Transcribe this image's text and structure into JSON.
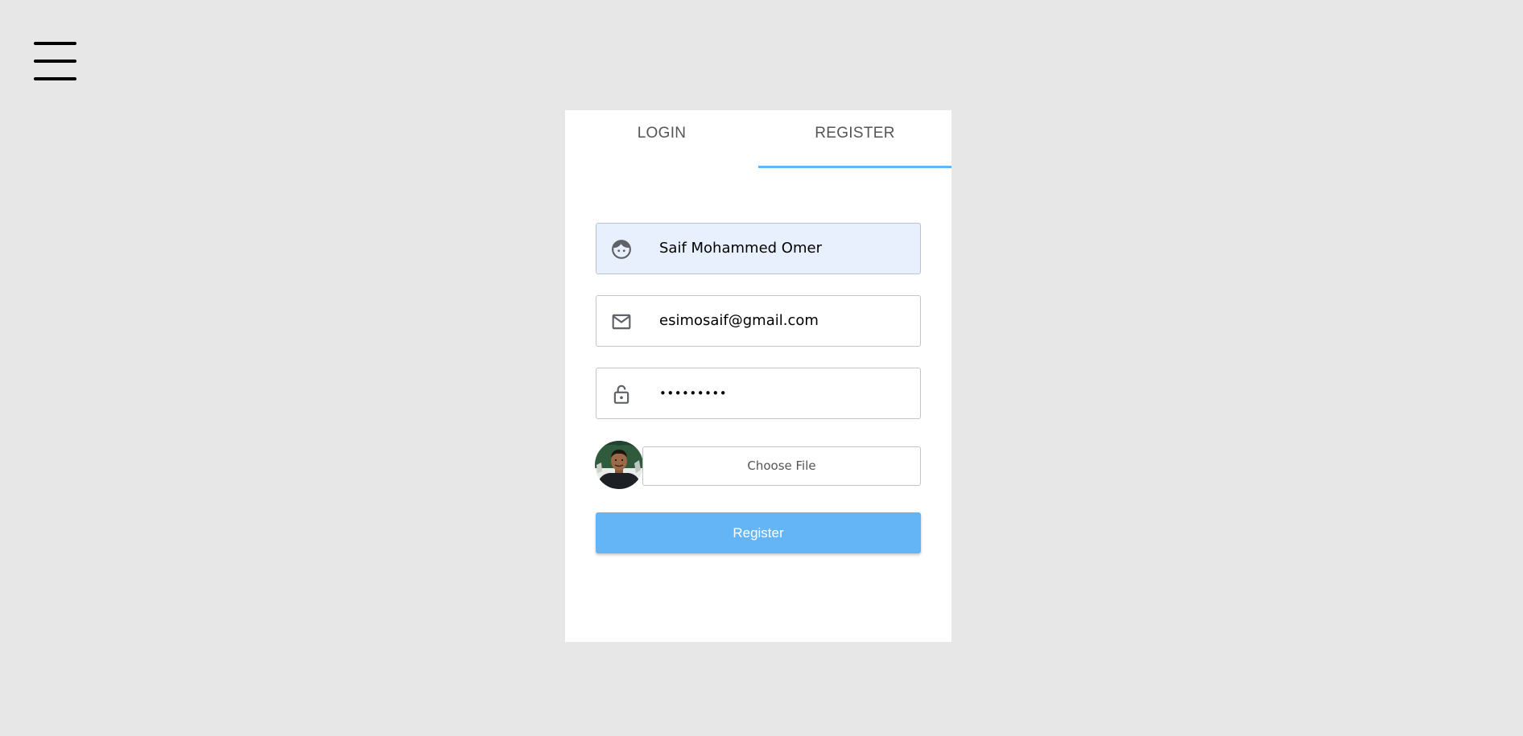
{
  "header": {
    "menu_icon": "hamburger-menu-icon"
  },
  "tabs": [
    {
      "label": "LOGIN",
      "active": false
    },
    {
      "label": "REGISTER",
      "active": true
    }
  ],
  "colors": {
    "accent": "#64b5f6",
    "background": "#e7e7e7",
    "card": "#ffffff",
    "autofill": "#e8f0fe"
  },
  "form": {
    "name": {
      "icon": "face-icon",
      "value": "Saif Mohammed Omer"
    },
    "email": {
      "icon": "mail-icon",
      "value": "esimosaif@gmail.com"
    },
    "password": {
      "icon": "lock-icon",
      "value": "•••••••••"
    },
    "avatar": {
      "icon": "avatar-photo"
    },
    "file": {
      "label": "Choose File"
    },
    "submit": {
      "label": "Register"
    }
  }
}
